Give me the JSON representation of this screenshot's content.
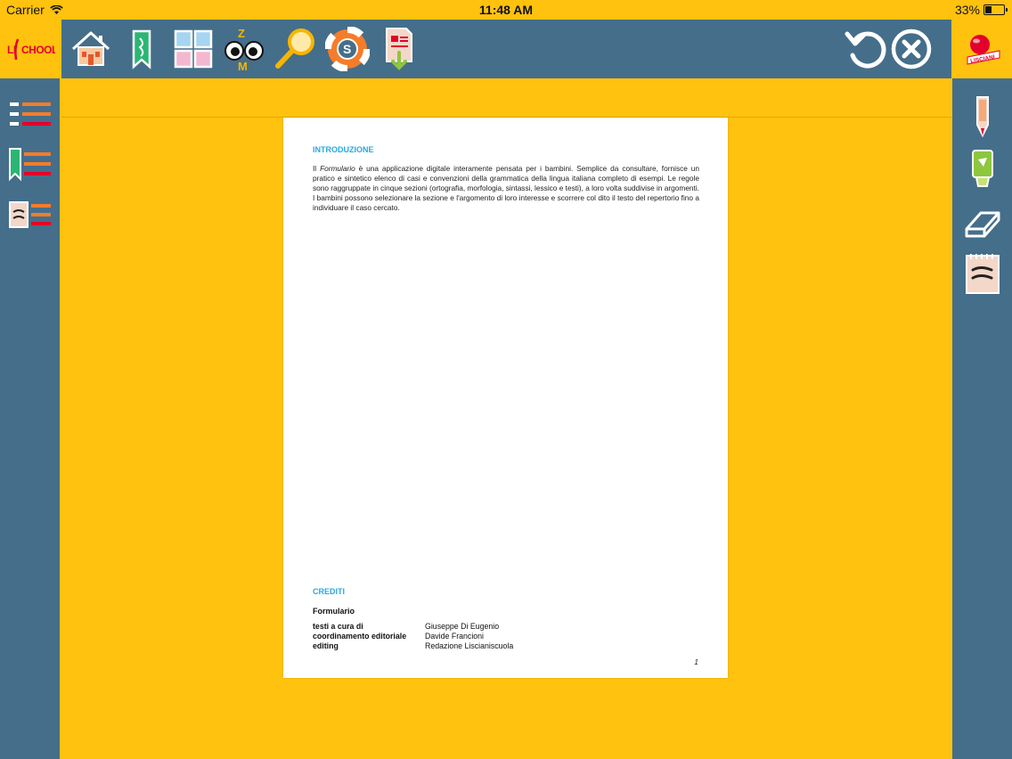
{
  "status_bar": {
    "carrier": "Carrier",
    "time": "11:48 AM",
    "battery": "33%",
    "battery_level": 0.33
  },
  "brand": {
    "logo_text": "LISCHOOL",
    "publisher": "LISCIANI"
  },
  "toolbar": {
    "tools": [
      "home-icon",
      "bookmark-icon",
      "grid-icon",
      "zoom-icon",
      "search-icon",
      "help-icon",
      "download-icon"
    ],
    "actions": [
      "undo-icon",
      "close-icon"
    ]
  },
  "left_sidebar": [
    "index-list-icon",
    "bookmarks-list-icon",
    "notes-list-icon"
  ],
  "right_sidebar": [
    "pencil-icon",
    "highlighter-icon",
    "eraser-icon",
    "note-icon"
  ],
  "page": {
    "heading": "INTRODUZIONE",
    "intro_prefix": "Il ",
    "intro_italic": "Formulario",
    "intro_text": " è una applicazione digitale interamente pensata per i bambini. Semplice da consultare, fornisce un pratico e sintetico elenco di casi e convenzioni della grammatica della lingua italiana completo di esempi. Le regole sono raggruppate in cinque sezioni (ortografia, morfologia, sintassi, lessico e testi), a loro volta suddivise in argomenti. I bambini possono selezionare la sezione e l'argomento di loro interesse e scorrere col dito il testo del repertorio fino a individuare il caso cercato.",
    "credits_heading": "CREDITI",
    "credits_title": "Formulario",
    "credits": [
      {
        "label": "testi a cura di",
        "value": "Giuseppe Di Eugenio"
      },
      {
        "label": "coordinamento editoriale",
        "value": "Davide Francioni"
      },
      {
        "label": "editing",
        "value": "Redazione Liscianiscuola"
      }
    ],
    "page_number": "1"
  },
  "colors": {
    "background": "#FFC20E",
    "toolbar": "#456E8A",
    "heading": "#29A8E0"
  }
}
